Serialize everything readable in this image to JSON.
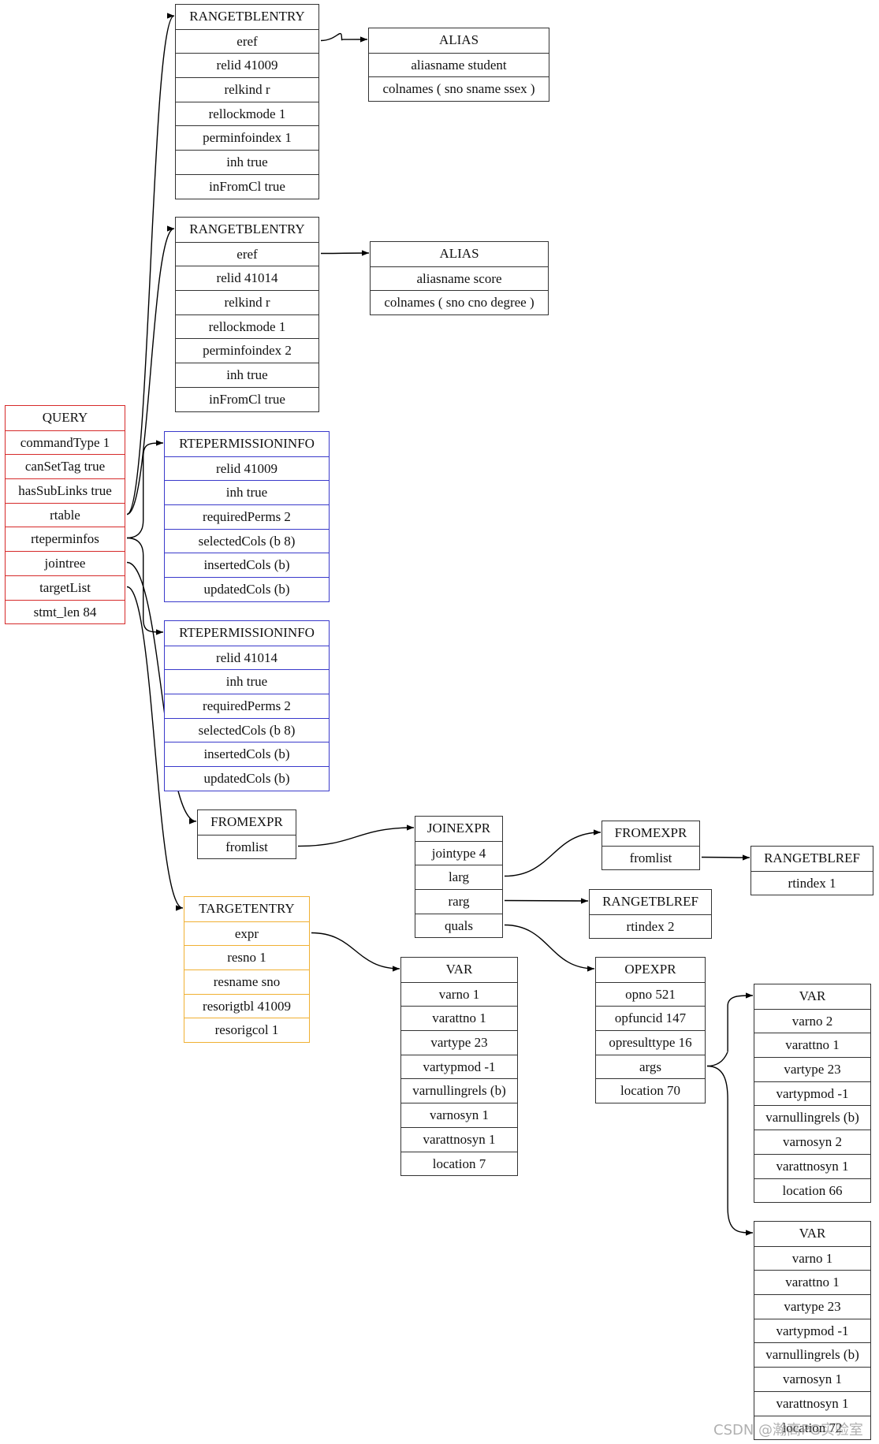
{
  "diagram": {
    "nodes": [
      {
        "id": "query",
        "color": "red",
        "rows": [
          "QUERY",
          "commandType 1",
          "canSetTag true",
          "hasSubLinks true",
          "rtable",
          "rteperminfos",
          "jointree",
          "targetList",
          "stmt_len 84"
        ]
      },
      {
        "id": "rte1",
        "color": "black",
        "rows": [
          "RANGETBLENTRY",
          "eref",
          "relid 41009",
          "relkind r",
          "rellockmode 1",
          "perminfoindex 1",
          "inh true",
          "inFromCl true"
        ]
      },
      {
        "id": "alias1",
        "color": "black",
        "rows": [
          "ALIAS",
          "aliasname student",
          "colnames ( sno sname ssex )"
        ]
      },
      {
        "id": "rte2",
        "color": "black",
        "rows": [
          "RANGETBLENTRY",
          "eref",
          "relid 41014",
          "relkind r",
          "rellockmode 1",
          "perminfoindex 2",
          "inh true",
          "inFromCl true"
        ]
      },
      {
        "id": "alias2",
        "color": "black",
        "rows": [
          "ALIAS",
          "aliasname score",
          "colnames ( sno cno degree )"
        ]
      },
      {
        "id": "perm1",
        "color": "blue",
        "rows": [
          "RTEPERMISSIONINFO",
          "relid 41009",
          "inh true",
          "requiredPerms 2",
          "selectedCols (b 8)",
          "insertedCols (b)",
          "updatedCols (b)"
        ]
      },
      {
        "id": "perm2",
        "color": "blue",
        "rows": [
          "RTEPERMISSIONINFO",
          "relid 41014",
          "inh true",
          "requiredPerms 2",
          "selectedCols (b 8)",
          "insertedCols (b)",
          "updatedCols (b)"
        ]
      },
      {
        "id": "fromexpr1",
        "color": "black",
        "rows": [
          "FROMEXPR",
          "fromlist"
        ]
      },
      {
        "id": "joinexpr",
        "color": "black",
        "rows": [
          "JOINEXPR",
          "jointype 4",
          "larg",
          "rarg",
          "quals"
        ]
      },
      {
        "id": "fromexpr2",
        "color": "black",
        "rows": [
          "FROMEXPR",
          "fromlist"
        ]
      },
      {
        "id": "rtref1",
        "color": "black",
        "rows": [
          "RANGETBLREF",
          "rtindex 1"
        ]
      },
      {
        "id": "rtref2",
        "color": "black",
        "rows": [
          "RANGETBLREF",
          "rtindex 2"
        ]
      },
      {
        "id": "targetentry",
        "color": "orange",
        "rows": [
          "TARGETENTRY",
          "expr",
          "resno 1",
          "resname sno",
          "resorigtbl 41009",
          "resorigcol 1"
        ]
      },
      {
        "id": "var1",
        "color": "black",
        "rows": [
          "VAR",
          "varno 1",
          "varattno 1",
          "vartype 23",
          "vartypmod -1",
          "varnullingrels (b)",
          "varnosyn 1",
          "varattnosyn 1",
          "location 7"
        ]
      },
      {
        "id": "opexpr",
        "color": "black",
        "rows": [
          "OPEXPR",
          "opno 521",
          "opfuncid 147",
          "opresulttype 16",
          "args",
          "location 70"
        ]
      },
      {
        "id": "var2",
        "color": "black",
        "rows": [
          "VAR",
          "varno 2",
          "varattno 1",
          "vartype 23",
          "vartypmod -1",
          "varnullingrels (b)",
          "varnosyn 2",
          "varattnosyn 1",
          "location 66"
        ]
      },
      {
        "id": "var3",
        "color": "black",
        "rows": [
          "VAR",
          "varno 1",
          "varattno 1",
          "vartype 23",
          "vartypmod -1",
          "varnullingrels (b)",
          "varnosyn 1",
          "varattnosyn 1",
          "location 72"
        ]
      }
    ],
    "edges": [
      {
        "from": "query.rtable",
        "to": "rte1"
      },
      {
        "from": "query.rtable",
        "to": "rte2"
      },
      {
        "from": "query.rteperminfos",
        "to": "perm1"
      },
      {
        "from": "query.rteperminfos",
        "to": "perm2"
      },
      {
        "from": "query.jointree",
        "to": "fromexpr1"
      },
      {
        "from": "query.targetList",
        "to": "targetentry"
      },
      {
        "from": "rte1.eref",
        "to": "alias1"
      },
      {
        "from": "rte2.eref",
        "to": "alias2"
      },
      {
        "from": "fromexpr1.fromlist",
        "to": "joinexpr"
      },
      {
        "from": "joinexpr.larg",
        "to": "fromexpr2"
      },
      {
        "from": "joinexpr.rarg",
        "to": "rtref2"
      },
      {
        "from": "joinexpr.quals",
        "to": "opexpr"
      },
      {
        "from": "fromexpr2.fromlist",
        "to": "rtref1"
      },
      {
        "from": "targetentry.expr",
        "to": "var1"
      },
      {
        "from": "opexpr.args",
        "to": "var2"
      },
      {
        "from": "opexpr.args",
        "to": "var3"
      }
    ]
  },
  "watermark": "CSDN @瀚高PG实验室"
}
